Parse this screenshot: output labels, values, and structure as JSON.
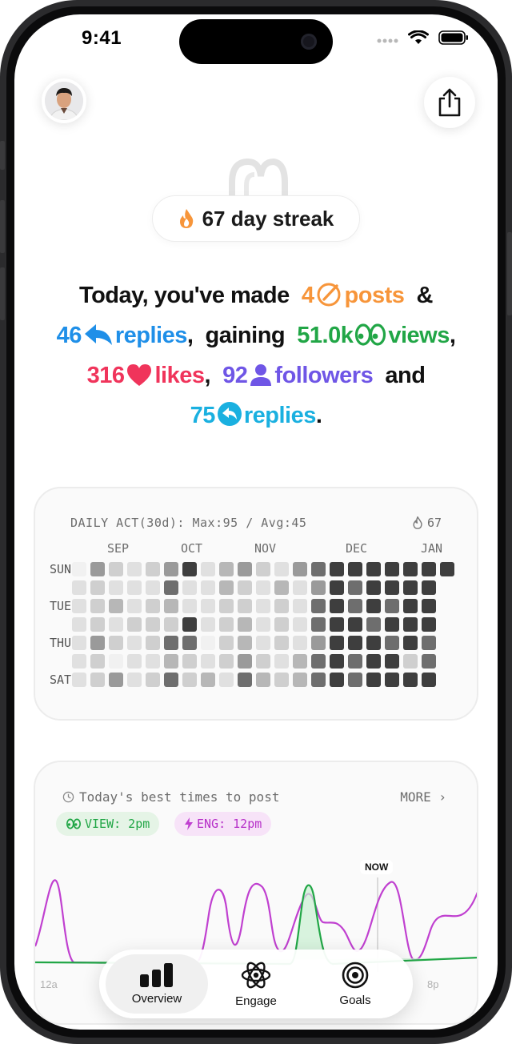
{
  "status_bar": {
    "time": "9:41"
  },
  "streak": {
    "label": "67 day streak"
  },
  "summary": {
    "lead": "Today, you've made",
    "posts_count": "4",
    "posts_label": "posts",
    "amp": "&",
    "replies_count": "46",
    "replies_label": "replies",
    "gaining": "gaining",
    "views_count": "51.0k",
    "views_label": "views",
    "likes_count": "316",
    "likes_label": "likes",
    "followers_count": "92",
    "followers_label": "followers",
    "and_word": "and",
    "replies2_count": "75",
    "replies2_label": "replies",
    "comma": ",",
    "period": "."
  },
  "activity": {
    "title": "DAILY ACT(30d): Max:95 / Avg:45",
    "streak": "67",
    "months": [
      "SEP",
      "OCT",
      "NOV",
      "DEC",
      "JAN"
    ],
    "days": [
      "SUN",
      "TUE",
      "THU",
      "SAT"
    ],
    "grid": [
      [
        0,
        4,
        2,
        1,
        2,
        4,
        6,
        1,
        3,
        4,
        2,
        1,
        4,
        5,
        6,
        6,
        6,
        6,
        6,
        6,
        6
      ],
      [
        1,
        2,
        1,
        1,
        1,
        5,
        1,
        1,
        3,
        2,
        1,
        3,
        1,
        4,
        6,
        5,
        6,
        6,
        6,
        6,
        -1
      ],
      [
        1,
        2,
        3,
        1,
        2,
        3,
        1,
        1,
        2,
        2,
        1,
        2,
        1,
        5,
        6,
        5,
        6,
        5,
        6,
        6,
        -1
      ],
      [
        1,
        2,
        1,
        2,
        2,
        2,
        6,
        1,
        2,
        3,
        1,
        2,
        1,
        5,
        6,
        6,
        5,
        6,
        6,
        6,
        -1
      ],
      [
        1,
        4,
        2,
        1,
        2,
        5,
        5,
        0,
        2,
        3,
        1,
        2,
        1,
        4,
        6,
        6,
        6,
        5,
        6,
        5,
        -1
      ],
      [
        1,
        2,
        0,
        1,
        1,
        3,
        2,
        1,
        2,
        4,
        2,
        1,
        3,
        5,
        6,
        5,
        6,
        6,
        2,
        5,
        -1
      ],
      [
        1,
        2,
        4,
        1,
        2,
        5,
        2,
        3,
        1,
        5,
        3,
        2,
        3,
        5,
        6,
        5,
        6,
        6,
        6,
        6,
        -1
      ]
    ],
    "palette": [
      "#f1f1f1",
      "#e0e0e0",
      "#cfcfcf",
      "#b7b7b7",
      "#9a9a9a",
      "#6e6e6e",
      "#3e3e3e"
    ]
  },
  "best_times": {
    "title": "Today's best times to post",
    "more": "MORE",
    "view_tag": "VIEW: 2pm",
    "eng_tag": "ENG: 12pm",
    "now_label": "NOW",
    "hour_start": "12a",
    "hour_end": "8p",
    "colors": {
      "views": "#21a646",
      "engagement": "#c040d0"
    }
  },
  "tabs": [
    {
      "label": "Overview",
      "active": true
    },
    {
      "label": "Engage",
      "active": false
    },
    {
      "label": "Goals",
      "active": false
    }
  ]
}
